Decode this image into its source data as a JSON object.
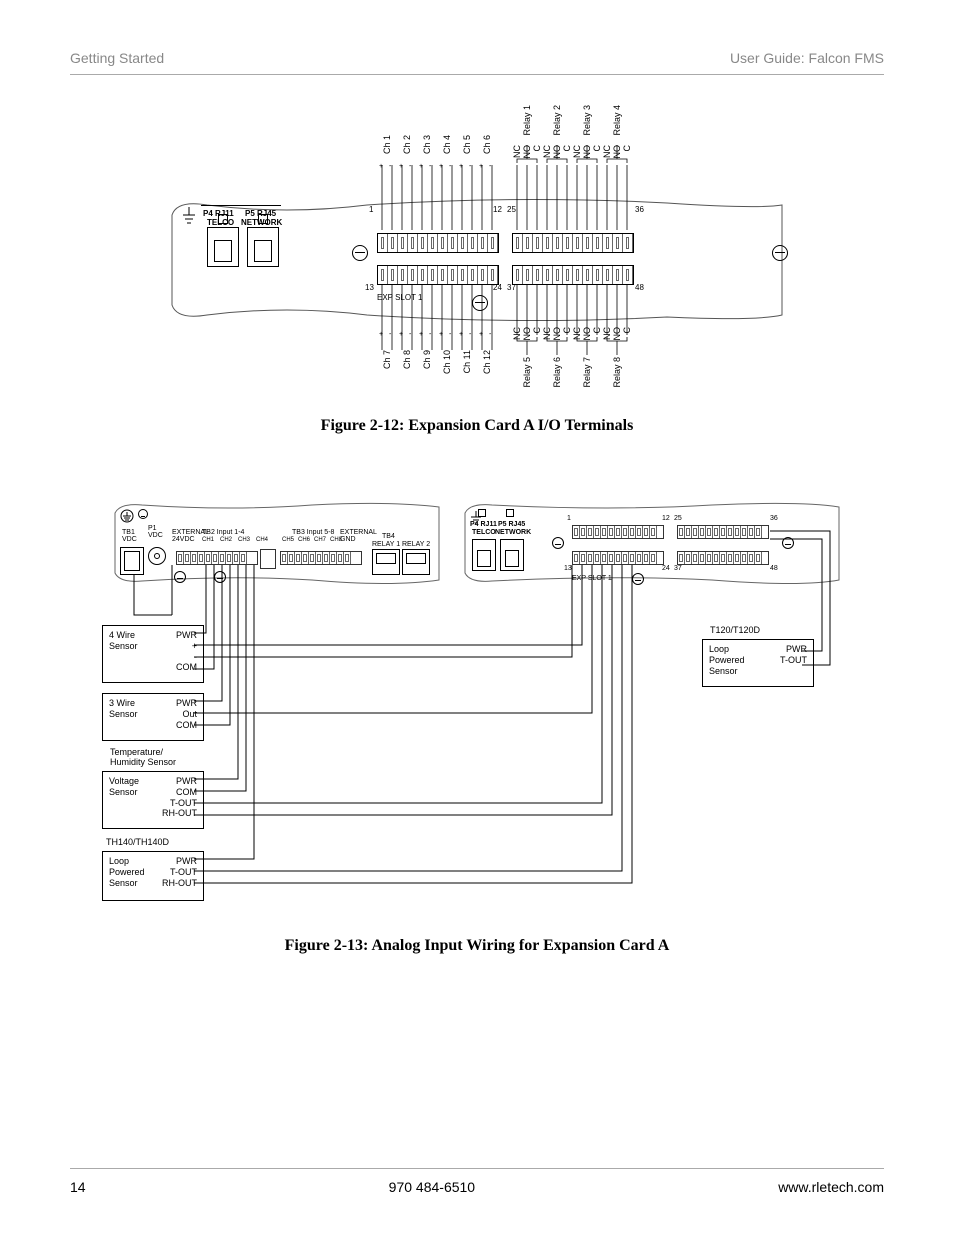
{
  "header": {
    "left": "Getting Started",
    "right": "User Guide: Falcon FMS"
  },
  "fig1": {
    "caption": "Figure 2-12: Expansion Card A I/O Terminals",
    "topChannels": [
      "Ch 1",
      "Ch 2",
      "Ch 3",
      "Ch 4",
      "Ch 5",
      "Ch 6"
    ],
    "bottomChannels": [
      "Ch 7",
      "Ch 8",
      "Ch 9",
      "Ch 10",
      "Ch 11",
      "Ch 12"
    ],
    "topRelays": [
      "Relay 1",
      "Relay 2",
      "Relay 3",
      "Relay 4"
    ],
    "bottomRelays": [
      "Relay 5",
      "Relay 6",
      "Relay 7",
      "Relay 8"
    ],
    "relayPins": [
      "NC",
      "NO",
      "C"
    ],
    "p4line1": "P4 RJ11",
    "p4line2": "TELCO",
    "p5line1": "P5 RJ45",
    "p5line2": "NETWORK",
    "expSlot": "EXP SLOT 1",
    "corners": {
      "tl": "1",
      "tm": "12",
      "tmr": "25",
      "tr": "36",
      "bl": "13",
      "bm": "24",
      "bmr": "37",
      "br": "48"
    },
    "polarity": [
      "+",
      "-"
    ]
  },
  "fig2": {
    "caption": "Figure 2-13: Analog Input Wiring for Expansion Card A",
    "leftBoard": {
      "tb1": "TB1\nVDC",
      "p1": "P1\nVDC",
      "ext": "EXTERNAL\n24VDC",
      "tb2": "TB2 Input 1-4",
      "tb2chs": [
        "CH1",
        "CH2",
        "CH3",
        "CH4"
      ],
      "tb3": "TB3 Input 5-8",
      "tb3chs": [
        "CH5",
        "CH6",
        "CH7",
        "CH8"
      ],
      "ext2": "EXTERNAL\nGND",
      "tb4": "TB4",
      "tb4r": [
        "RELAY 1",
        "RELAY 2"
      ]
    },
    "rightBoard": {
      "p4a": "P4 RJ11",
      "p4b": "TELCO",
      "p5a": "P5 RJ45",
      "p5b": "NETWORK",
      "expSlot": "EXP SLOT 1",
      "nums": [
        "1",
        "12",
        "25",
        "36",
        "13",
        "24",
        "37",
        "48"
      ]
    },
    "sensors": {
      "s4w": {
        "title": "4 Wire\nSensor",
        "pins": [
          "PWR",
          "+",
          "-",
          "COM"
        ]
      },
      "s3w": {
        "title": "3 Wire\nSensor",
        "pins": [
          "PWR",
          "Out",
          "COM"
        ]
      },
      "thHeader": "Temperature/\nHumidity Sensor",
      "volt": {
        "title": "Voltage\nSensor",
        "pins": [
          "PWR",
          "COM",
          "T-OUT",
          "RH-OUT"
        ]
      },
      "th140Header": "TH140/TH140D",
      "loopL": {
        "title": "Loop\nPowered\nSensor",
        "pins": [
          "PWR",
          "T-OUT",
          "RH-OUT"
        ]
      },
      "t120Header": "T120/T120D",
      "loopR": {
        "title": "Loop\nPowered\nSensor",
        "pins": [
          "PWR",
          "T-OUT"
        ]
      }
    }
  },
  "footer": {
    "page": "14",
    "phone": "970 484-6510",
    "url": "www.rletech.com"
  }
}
